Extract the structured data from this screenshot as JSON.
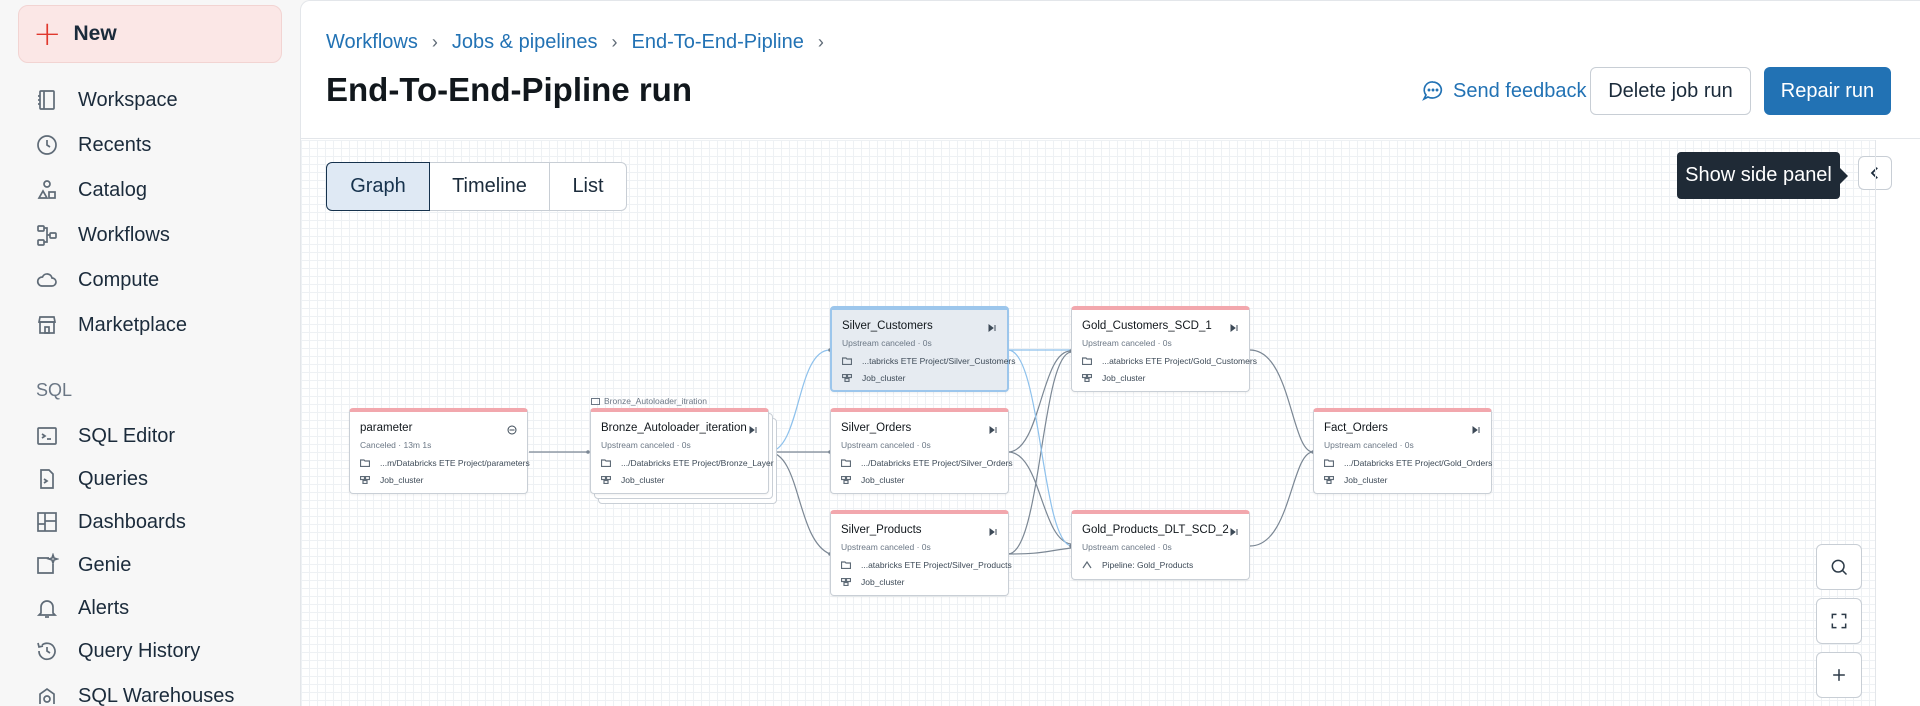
{
  "sidebar": {
    "new_label": "New",
    "items": [
      {
        "label": "Workspace",
        "icon": "workspace-icon"
      },
      {
        "label": "Recents",
        "icon": "clock-icon"
      },
      {
        "label": "Catalog",
        "icon": "catalog-icon"
      },
      {
        "label": "Workflows",
        "icon": "workflows-icon"
      },
      {
        "label": "Compute",
        "icon": "cloud-icon"
      },
      {
        "label": "Marketplace",
        "icon": "store-icon"
      }
    ],
    "sql_section": "SQL",
    "sql_items": [
      {
        "label": "SQL Editor",
        "icon": "terminal-icon"
      },
      {
        "label": "Queries",
        "icon": "query-icon"
      },
      {
        "label": "Dashboards",
        "icon": "dashboard-icon"
      },
      {
        "label": "Genie",
        "icon": "genie-icon"
      },
      {
        "label": "Alerts",
        "icon": "bell-icon"
      },
      {
        "label": "Query History",
        "icon": "history-icon"
      },
      {
        "label": "SQL Warehouses",
        "icon": "warehouse-icon"
      }
    ]
  },
  "header": {
    "breadcrumbs": [
      "Workflows",
      "Jobs & pipelines",
      "End-To-End-Pipline"
    ],
    "title": "End-To-End-Pipline run",
    "feedback_label": "Send feedback",
    "delete_label": "Delete job run",
    "repair_label": "Repair run"
  },
  "colors": {
    "accent": "#2272b4",
    "failed_bar": "#f2a7ad",
    "selected_border": "#9cc6ec",
    "new_button_bg": "#fbe7e6"
  },
  "view_tabs": [
    "Graph",
    "Timeline",
    "List"
  ],
  "active_tab": "Graph",
  "tooltip": "Show side panel",
  "graph": {
    "iteration_tag": "Bronze_Autoloader_itration",
    "nodes": {
      "parameter": {
        "name": "parameter",
        "status": "Canceled  ·  13m 1s",
        "path": "...m/Databricks ETE Project/parameters",
        "cluster": "Job_cluster"
      },
      "bronze": {
        "name": "Bronze_Autoloader_iteration",
        "status": "Upstream canceled  ·  0s",
        "path": ".../Databricks ETE Project/Bronze_Layer",
        "cluster": "Job_cluster"
      },
      "silver_customers": {
        "name": "Silver_Customers",
        "status": "Upstream canceled  ·  0s",
        "path": "...tabricks ETE Project/Silver_Customers",
        "cluster": "Job_cluster"
      },
      "silver_orders": {
        "name": "Silver_Orders",
        "status": "Upstream canceled  ·  0s",
        "path": ".../Databricks ETE Project/Silver_Orders",
        "cluster": "Job_cluster"
      },
      "silver_products": {
        "name": "Silver_Products",
        "status": "Upstream canceled  ·  0s",
        "path": "...atabricks ETE Project/Silver_Products",
        "cluster": "Job_cluster"
      },
      "gold_customers": {
        "name": "Gold_Customers_SCD_1",
        "status": "Upstream canceled  ·  0s",
        "path": "...atabricks ETE Project/Gold_Customers",
        "cluster": "Job_cluster"
      },
      "gold_products": {
        "name": "Gold_Products_DLT_SCD_2",
        "status": "Upstream canceled  ·  0s",
        "pipeline": "Pipeline:  Gold_Products"
      },
      "fact_orders": {
        "name": "Fact_Orders",
        "status": "Upstream canceled  ·  0s",
        "path": ".../Databricks ETE Project/Gold_Orders",
        "cluster": "Job_cluster"
      }
    }
  }
}
